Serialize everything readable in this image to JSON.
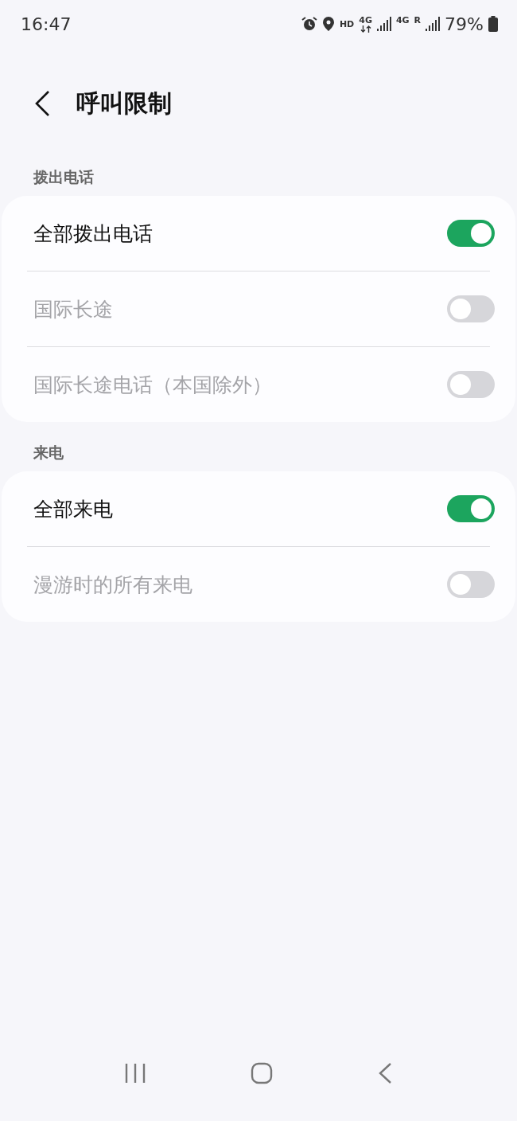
{
  "status_bar": {
    "time": "16:47",
    "hd": "HD",
    "network_1": "4G",
    "network_2": "4G",
    "roaming": "R",
    "battery": "79%"
  },
  "header": {
    "title": "呼叫限制"
  },
  "sections": [
    {
      "title": "拨出电话",
      "rows": [
        {
          "label": "全部拨出电话",
          "on": true,
          "disabled": false
        },
        {
          "label": "国际长途",
          "on": false,
          "disabled": true
        },
        {
          "label": "国际长途电话（本国除外）",
          "on": false,
          "disabled": true
        }
      ]
    },
    {
      "title": "来电",
      "rows": [
        {
          "label": "全部来电",
          "on": true,
          "disabled": false
        },
        {
          "label": "漫游时的所有来电",
          "on": false,
          "disabled": true
        }
      ]
    }
  ]
}
